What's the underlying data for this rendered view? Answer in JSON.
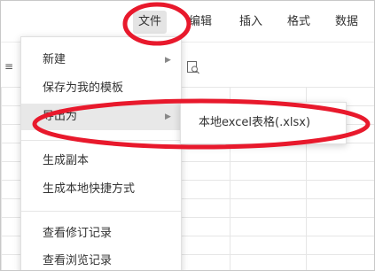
{
  "menubar": {
    "items": [
      {
        "label": "文件"
      },
      {
        "label": "编辑"
      },
      {
        "label": "插入"
      },
      {
        "label": "格式"
      },
      {
        "label": "数据"
      }
    ]
  },
  "file_menu": {
    "items": [
      {
        "label": "新建"
      },
      {
        "label": "保存为我的模板"
      },
      {
        "label": "导出为"
      },
      {
        "label": "生成副本"
      },
      {
        "label": "生成本地快捷方式"
      },
      {
        "label": "查看修订记录"
      },
      {
        "label": "查看浏览记录"
      }
    ]
  },
  "export_submenu": {
    "items": [
      {
        "label": "本地excel表格(.xlsx)"
      }
    ]
  },
  "toolbar": {
    "left_icon": "format-icon",
    "right_icon": "find-icon"
  },
  "colors": {
    "annotation_red": "#e8192c",
    "hover_gray": "#e8e8e8"
  }
}
